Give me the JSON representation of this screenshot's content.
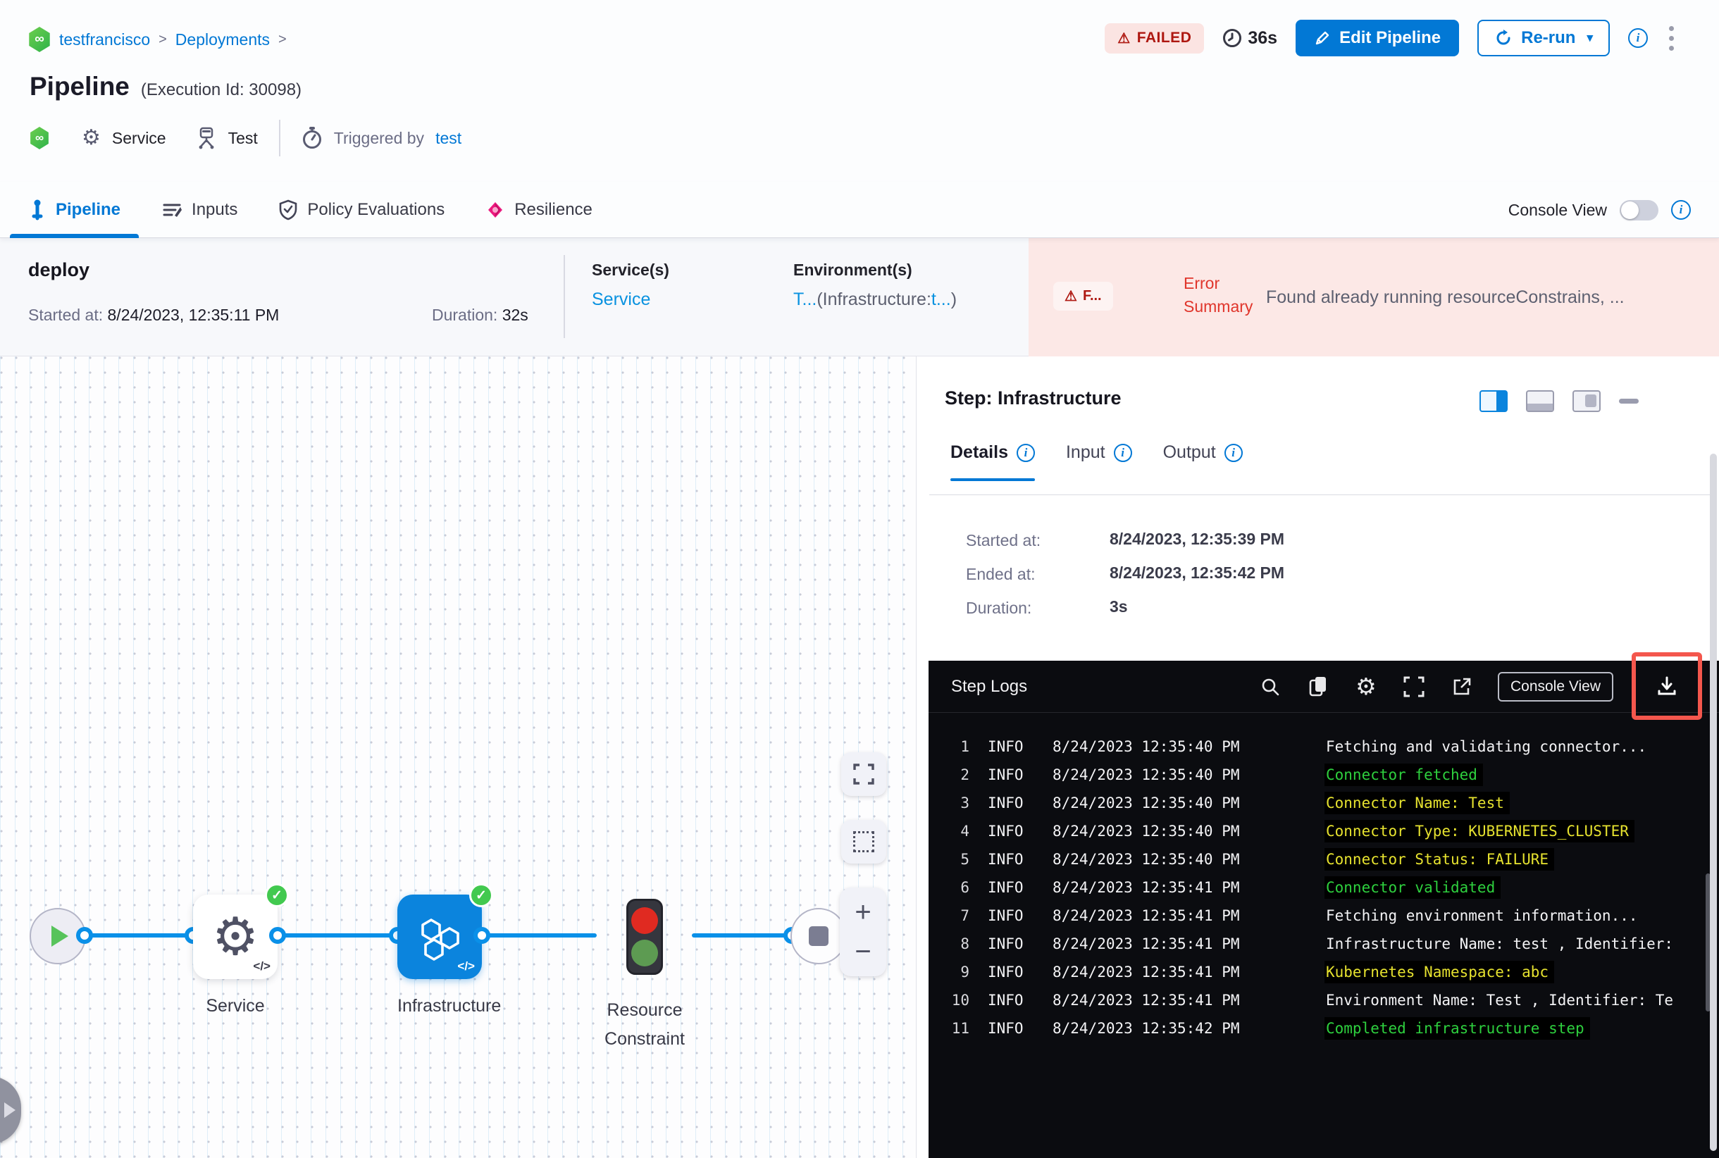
{
  "breadcrumb": {
    "project": "testfrancisco",
    "section": "Deployments",
    "sep": ">"
  },
  "header": {
    "title": "Pipeline",
    "execution_id": "(Execution Id: 30098)",
    "status": "FAILED",
    "total_duration": "36s",
    "edit_button": "Edit Pipeline",
    "rerun_button": "Re-run",
    "service_label": "Service",
    "test_label": "Test",
    "triggered_by_label": "Triggered by",
    "triggered_by_user": "test",
    "module_icon_glyph": "∞"
  },
  "tabs": [
    {
      "label": "Pipeline"
    },
    {
      "label": "Inputs"
    },
    {
      "label": "Policy Evaluations"
    },
    {
      "label": "Resilience"
    }
  ],
  "console_view": {
    "label": "Console View"
  },
  "stage": {
    "name": "deploy",
    "started_label": "Started at:",
    "started_value": "8/24/2023, 12:35:11 PM",
    "duration_label": "Duration:",
    "duration_value": "32s",
    "services_label": "Service(s)",
    "service_link": "Service",
    "environments_label": "Environment(s)",
    "env_prefix": "T...",
    "env_mid": "(Infrastructure:",
    "env_link": "t...",
    "env_suffix": ")",
    "error_badge": "F...",
    "error_warn_glyph": "⚠",
    "error_summary_label": "Error Summary",
    "error_message": "Found already running resourceConstrains, ..."
  },
  "graph": {
    "nodes": [
      {
        "label": "Service"
      },
      {
        "label": "Infrastructure"
      },
      {
        "label": "Resource Constraint"
      }
    ],
    "code_glyph": "</>",
    "check_glyph": "✓",
    "zoom_in_glyph": "+",
    "zoom_out_glyph": "−"
  },
  "step_panel": {
    "title": "Step: Infrastructure",
    "tabs": [
      {
        "label": "Details"
      },
      {
        "label": "Input"
      },
      {
        "label": "Output"
      }
    ],
    "details": [
      {
        "label": "Started at:",
        "value": "8/24/2023, 12:35:39 PM"
      },
      {
        "label": "Ended at:",
        "value": "8/24/2023, 12:35:42 PM"
      },
      {
        "label": "Duration:",
        "value": "3s"
      }
    ]
  },
  "logs": {
    "title": "Step Logs",
    "console_view_button": "Console View",
    "lines": [
      {
        "num": "1",
        "level": "INFO",
        "time": "8/24/2023 12:35:40 PM",
        "msg": "Fetching and validating connector...",
        "color": "white"
      },
      {
        "num": "2",
        "level": "INFO",
        "time": "8/24/2023 12:35:40 PM",
        "msg": "Connector fetched",
        "color": "green"
      },
      {
        "num": "3",
        "level": "INFO",
        "time": "8/24/2023 12:35:40 PM",
        "msg": "Connector Name: Test",
        "color": "yellow"
      },
      {
        "num": "4",
        "level": "INFO",
        "time": "8/24/2023 12:35:40 PM",
        "msg": "Connector Type: KUBERNETES_CLUSTER",
        "color": "yellow"
      },
      {
        "num": "5",
        "level": "INFO",
        "time": "8/24/2023 12:35:40 PM",
        "msg": "Connector Status: FAILURE",
        "color": "yellow"
      },
      {
        "num": "6",
        "level": "INFO",
        "time": "8/24/2023 12:35:41 PM",
        "msg": "Connector validated",
        "color": "green"
      },
      {
        "num": "7",
        "level": "INFO",
        "time": "8/24/2023 12:35:41 PM",
        "msg": "Fetching environment information...",
        "color": "white"
      },
      {
        "num": "8",
        "level": "INFO",
        "time": "8/24/2023 12:35:41 PM",
        "msg": "Infrastructure Name: test , Identifier:",
        "color": "white"
      },
      {
        "num": "9",
        "level": "INFO",
        "time": "8/24/2023 12:35:41 PM",
        "msg": "Kubernetes Namespace: abc",
        "color": "yellow"
      },
      {
        "num": "10",
        "level": "INFO",
        "time": "8/24/2023 12:35:41 PM",
        "msg": "Environment Name: Test , Identifier: Te",
        "color": "white"
      },
      {
        "num": "11",
        "level": "INFO",
        "time": "8/24/2023 12:35:42 PM",
        "msg": "Completed infrastructure step",
        "color": "green"
      }
    ]
  },
  "colors": {
    "accent_blue": "#0278d5",
    "edge_blue": "#0a90e8",
    "failed_red": "#ae1710",
    "error_bg": "#fce8e6",
    "success_green": "#42c94f",
    "log_green": "#2ed03e",
    "log_yellow": "#e6e22f",
    "highlight_box_red": "#f4574d"
  }
}
